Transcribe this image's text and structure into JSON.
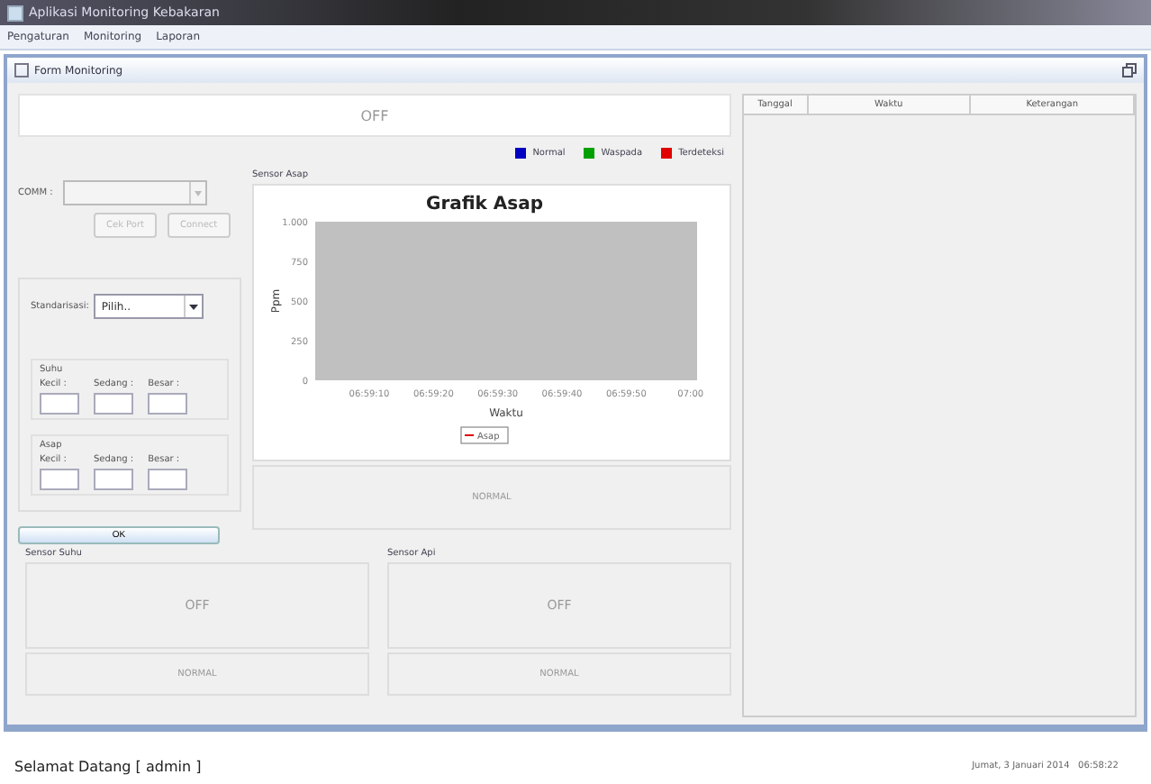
{
  "window": {
    "title": "Aplikasi Monitoring Kebakaran"
  },
  "menu": [
    "Pengaturan",
    "Monitoring",
    "Laporan"
  ],
  "frame": {
    "title": "Form Monitoring"
  },
  "status_banner": "OFF",
  "legend": [
    {
      "label": "Normal",
      "color": "#0000c0"
    },
    {
      "label": "Waspada",
      "color": "#00a000"
    },
    {
      "label": "Terdeteksi",
      "color": "#e00000"
    }
  ],
  "connection": {
    "label": "COMM :",
    "buttons": [
      {
        "label": "Cek Port",
        "disabled": true
      },
      {
        "label": "Connect",
        "disabled": true
      }
    ]
  },
  "standard": {
    "label": "Standarisasi:",
    "value": "Pilih.."
  },
  "thresholds": [
    {
      "title": "Suhu",
      "fields": [
        "Kecil :",
        "Sedang :",
        "Besar :"
      ]
    },
    {
      "title": "Asap",
      "fields": [
        "Kecil :",
        "Sedang :",
        "Besar :"
      ]
    }
  ],
  "ok_button": "OK",
  "smoke_sensor": {
    "title": "Sensor Asap",
    "status": "NORMAL",
    "chart_data": {
      "type": "line",
      "title": "Grafik Asap",
      "xlabel": "Waktu",
      "ylabel": "Ppm",
      "categories": [
        "06:59:10",
        "06:59:20",
        "06:59:30",
        "06:59:40",
        "06:59:50",
        "07:00"
      ],
      "series": [
        {
          "name": "Asap",
          "color": "#e00000",
          "values": [
            null,
            null,
            null,
            null,
            null,
            null
          ]
        }
      ],
      "ylim": [
        0,
        1000
      ],
      "yticks": [
        {
          "value": 0,
          "label": "0"
        },
        {
          "value": 250,
          "label": "250"
        },
        {
          "value": 500,
          "label": "500"
        },
        {
          "value": 750,
          "label": "750"
        },
        {
          "value": 1000,
          "label": "1.000"
        }
      ]
    }
  },
  "sensors": [
    {
      "title": "Sensor Suhu",
      "value": "OFF",
      "status": "NORMAL"
    },
    {
      "title": "Sensor Api",
      "value": "OFF",
      "status": "NORMAL"
    }
  ],
  "table": {
    "columns": [
      "Tanggal",
      "Waktu",
      "Keterangan"
    ]
  },
  "status_bar": {
    "welcome": "Selamat Datang [ admin ]",
    "datetime": "Jumat, 3 Januari 2014   06:58:22"
  }
}
